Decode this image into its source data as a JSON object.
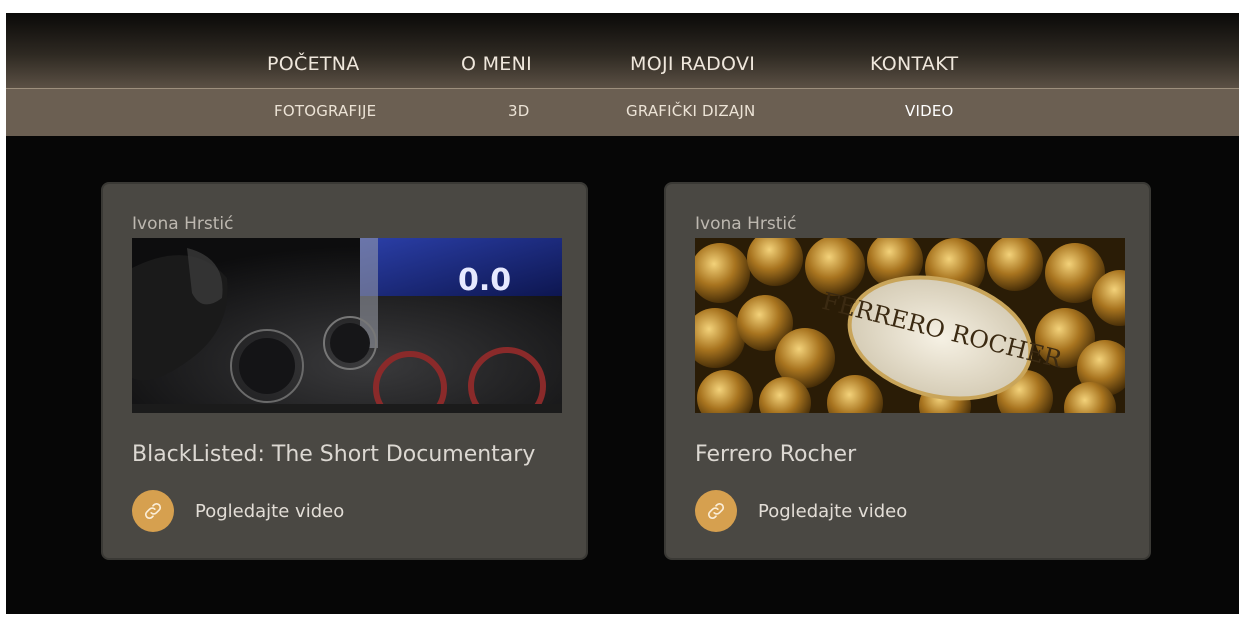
{
  "nav": {
    "main": [
      {
        "label": "POČETNA"
      },
      {
        "label": "O MENI"
      },
      {
        "label": "MOJI RADOVI"
      },
      {
        "label": "KONTAKT"
      }
    ],
    "sub": [
      {
        "label": "FOTOGRAFIJE"
      },
      {
        "label": "3D"
      },
      {
        "label": "GRAFIČKI DIZAJN"
      },
      {
        "label": "VIDEO",
        "active": true
      }
    ]
  },
  "cards": [
    {
      "author": "Ivona Hrstić",
      "thumb_readout": "0.0",
      "title": "BlackListed: The Short Documentary",
      "link_label": "Pogledajte video",
      "link_icon": "link-icon"
    },
    {
      "author": "Ivona Hrstić",
      "thumb_brand": "FERRERO ROCHER",
      "title": "Ferrero Rocher",
      "link_label": "Pogledajte video",
      "link_icon": "link-icon"
    }
  ],
  "colors": {
    "accent": "#d6a04f",
    "card_bg": "#4a4843",
    "subnav_bg": "#6b5f52",
    "page_bg": "#060606"
  }
}
